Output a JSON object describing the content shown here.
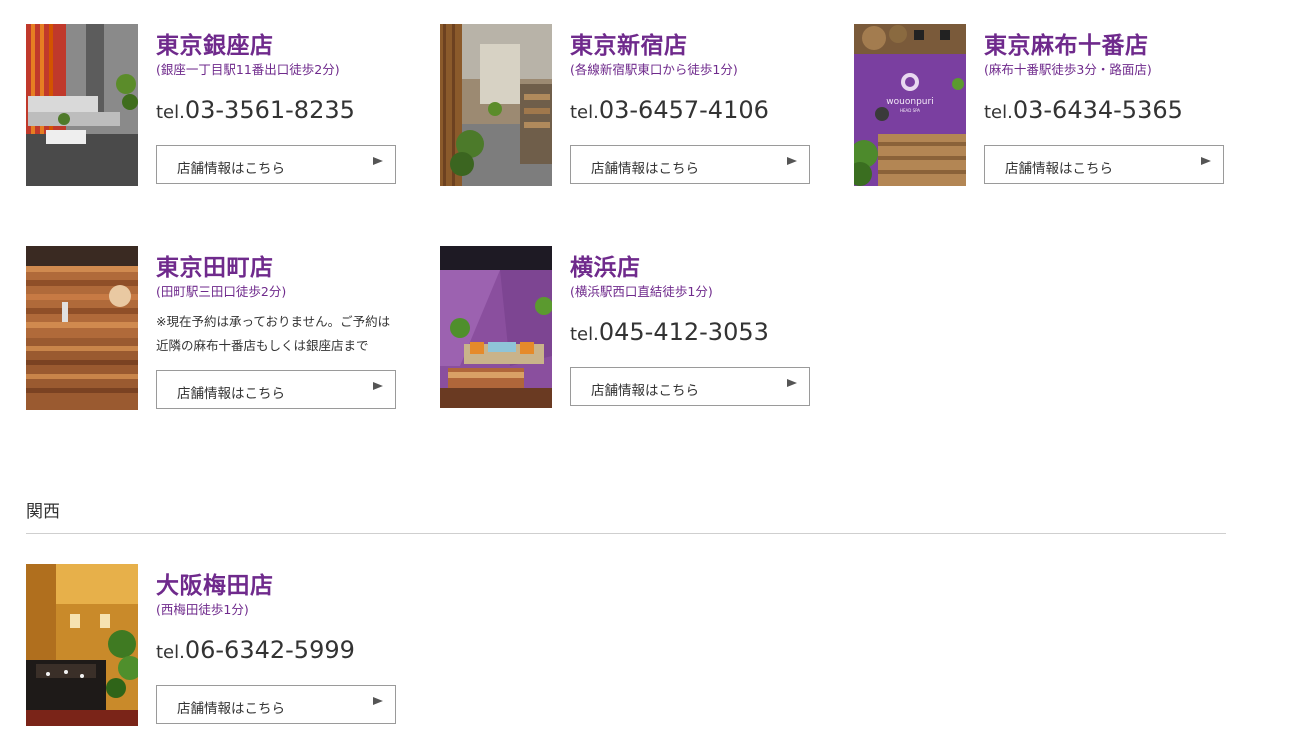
{
  "stores": [
    {
      "name": "東京銀座店",
      "access": "(銀座一丁目駅11番出口徒歩2分)",
      "tel_prefix": "tel.",
      "tel": "03-3561-8235",
      "button_label": "店舗情報はこちら"
    },
    {
      "name": "東京新宿店",
      "access": "(各線新宿駅東口から徒歩1分)",
      "tel_prefix": "tel.",
      "tel": "03-6457-4106",
      "button_label": "店舗情報はこちら"
    },
    {
      "name": "東京麻布十番店",
      "access": "(麻布十番駅徒歩3分・路面店)",
      "tel_prefix": "tel.",
      "tel": "03-6434-5365",
      "button_label": "店舗情報はこちら",
      "image_logo_text": "wouonpuri HEAD SPA"
    },
    {
      "name": "東京田町店",
      "access": "(田町駅三田口徒歩2分)",
      "note": "※現在予約は承っておりません。ご予約は近隣の麻布十番店もしくは銀座店まで",
      "button_label": "店舗情報はこちら"
    },
    {
      "name": "横浜店",
      "access": "(横浜駅西口直結徒歩1分)",
      "tel_prefix": "tel.",
      "tel": "045-412-3053",
      "button_label": "店舗情報はこちら"
    }
  ],
  "region_kansai": {
    "heading": "関西",
    "stores": [
      {
        "name": "大阪梅田店",
        "access": "(西梅田徒歩1分)",
        "tel_prefix": "tel.",
        "tel": "06-6342-5999",
        "button_label": "店舗情報はこちら"
      }
    ]
  },
  "colors": {
    "accent": "#6f2a8c",
    "text": "#333333",
    "button_border": "#9a9a9a",
    "divider": "#cfcfcf"
  },
  "icons": {
    "button_arrow": "triangle-right-icon"
  }
}
